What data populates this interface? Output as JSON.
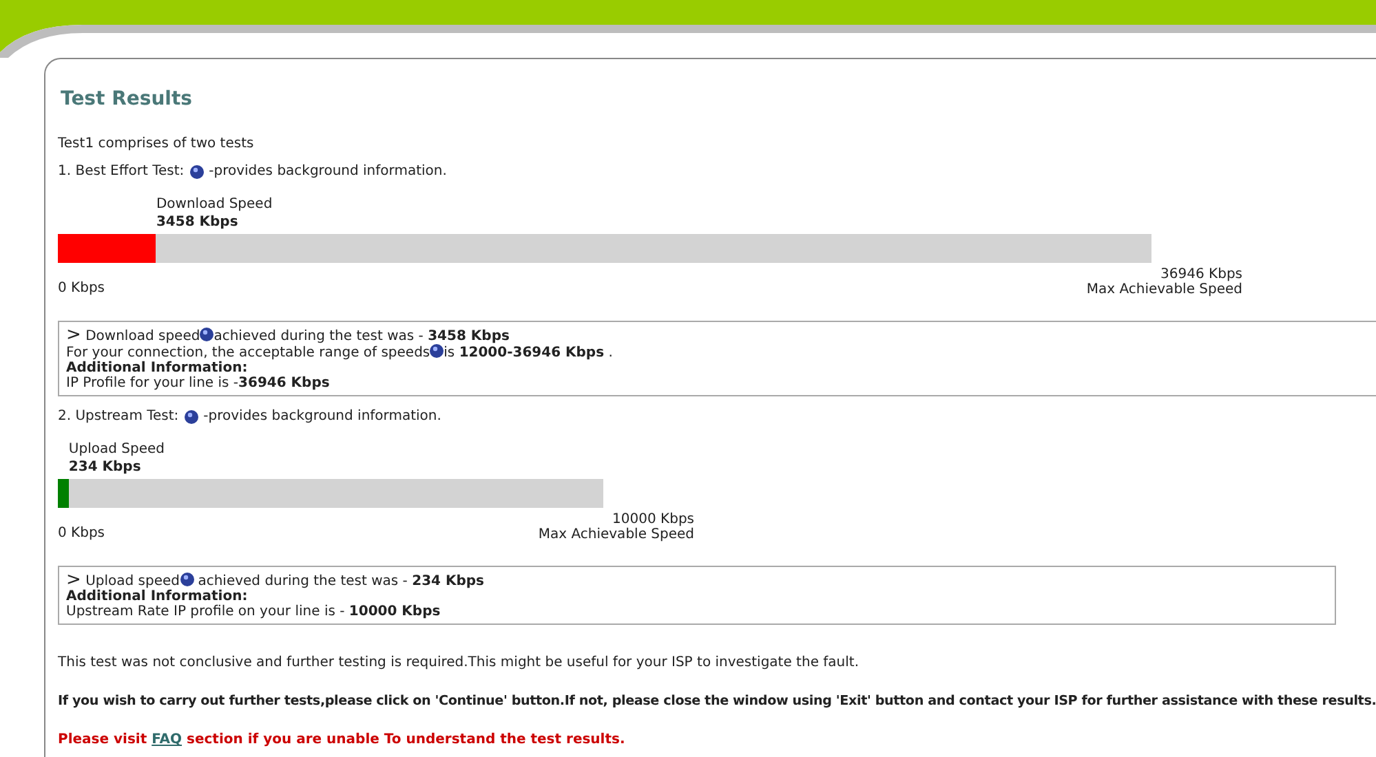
{
  "header": {
    "title": "Test Results"
  },
  "intro": "Test1 comprises of two tests",
  "tests": [
    {
      "kind": "download",
      "heading_before": "1. Best Effort Test:",
      "heading_after": "-provides background information.",
      "speed_label": "Download Speed",
      "speed_value": "3458 Kbps",
      "level": 0.09,
      "color": "#ff0000",
      "min_label": "0 Kbps",
      "max_value": "36946 Kbps",
      "max_label": "Max Achievable Speed",
      "info": [
        {
          "kind": "text",
          "arrow": ">",
          "segments": [
            "Download speed",
            "achieved during the test was - **3458 Kbps**"
          ]
        },
        {
          "kind": "text",
          "segments": [
            "For your connection, the acceptable range of speeds",
            "is **12000-36946 Kbps** ."
          ]
        },
        {
          "kind": "heading",
          "segments": [
            "Additional Information:"
          ]
        },
        {
          "kind": "text",
          "segments": [
            "IP Profile for your line is -**36946 Kbps**"
          ]
        }
      ]
    },
    {
      "kind": "upload",
      "heading_before": "2. Upstream Test:",
      "heading_after": "-provides background information.",
      "speed_label": "Upload Speed",
      "speed_value": "234 Kbps",
      "level": 0.02,
      "color": "#008000",
      "min_label": "0 Kbps",
      "max_value": "10000 Kbps",
      "max_label": "Max Achievable Speed",
      "info": [
        {
          "kind": "text",
          "arrow": ">",
          "segments": [
            "Upload speed",
            " achieved during the test was - **234 Kbps**"
          ]
        },
        {
          "kind": "heading",
          "segments": [
            "Additional Information:"
          ]
        },
        {
          "kind": "text",
          "segments": [
            "Upstream Rate IP profile on your line is - **10000 Kbps**"
          ]
        }
      ]
    }
  ],
  "notes": [
    {
      "kind": "plain",
      "text": "This test was not conclusive and further testing is required.This might be useful for your ISP to investigate the fault."
    },
    {
      "kind": "bold",
      "text": "If you wish to carry out further tests,please click on 'Continue' button.If not, please close the window using 'Exit' button and contact your ISP for further assistance with these results."
    },
    {
      "kind": "warning",
      "before": "Please visit",
      "link": "FAQ",
      "after": "section if you are unable To understand the test results."
    }
  ]
}
